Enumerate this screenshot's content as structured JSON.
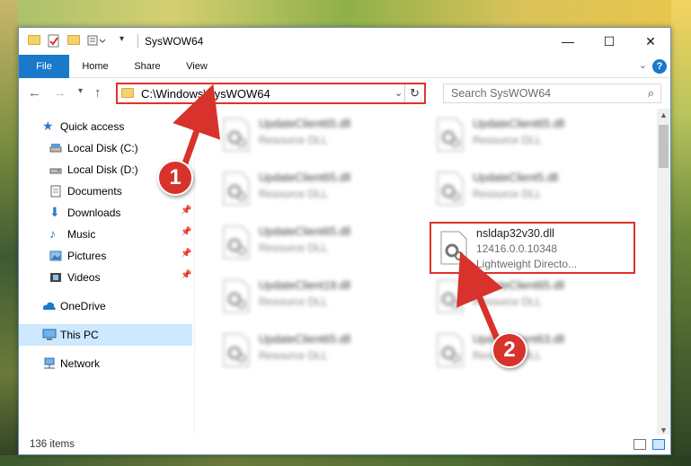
{
  "window": {
    "title": "SysWOW64",
    "minimize_glyph": "—",
    "maximize_glyph": "☐",
    "close_glyph": "✕"
  },
  "ribbon": {
    "tabs": [
      "File",
      "Home",
      "Share",
      "View"
    ],
    "help": "?"
  },
  "address": {
    "path": "C:\\Windows\\SysWOW64"
  },
  "search": {
    "placeholder": "Search SysWOW64"
  },
  "sidebar": {
    "items": [
      {
        "label": "Quick access",
        "icon": "star-icon",
        "pinned": false
      },
      {
        "label": "Local Disk (C:)",
        "icon": "drive-icon",
        "pinned": false
      },
      {
        "label": "Local Disk (D:)",
        "icon": "drive-icon",
        "pinned": false
      },
      {
        "label": "Documents",
        "icon": "documents-icon",
        "pinned": false
      },
      {
        "label": "Downloads",
        "icon": "download-icon",
        "pinned": true
      },
      {
        "label": "Music",
        "icon": "music-icon",
        "pinned": true
      },
      {
        "label": "Pictures",
        "icon": "pictures-icon",
        "pinned": true
      },
      {
        "label": "Videos",
        "icon": "videos-icon",
        "pinned": true
      },
      {
        "label": "OneDrive",
        "icon": "cloud-icon",
        "pinned": false
      },
      {
        "label": "This PC",
        "icon": "computer-icon",
        "pinned": false,
        "selected": true
      },
      {
        "label": "Network",
        "icon": "network-icon",
        "pinned": false
      }
    ]
  },
  "files": [
    {
      "name": "UpdateClient65.dll",
      "desc": "Resource DLL"
    },
    {
      "name": "UpdateClient65.dll",
      "desc": "Resource DLL"
    },
    {
      "name": "UpdateClient65.dll",
      "desc": "Resource DLL"
    },
    {
      "name": "UpdateClient5.dll",
      "desc": "Resource DLL"
    },
    {
      "name": "UpdateClient65.dll",
      "desc": "Resource DLL"
    },
    {
      "name": "nsldap32v30.dll",
      "desc": "12416.0.0.10348",
      "extra": "Lightweight Directo...",
      "highlighted": true
    },
    {
      "name": "UpdateClient19.dll",
      "desc": "Resource DLL"
    },
    {
      "name": "UpdateClient65.dll",
      "desc": "Resource DLL"
    },
    {
      "name": "UpdateClient65.dll",
      "desc": "Resource DLL"
    },
    {
      "name": "UpdateClient63.dll",
      "desc": "Resource DLL"
    }
  ],
  "status": {
    "count": "136 items"
  },
  "callouts": [
    "1",
    "2"
  ],
  "colors": {
    "accent": "#1979ca",
    "highlight_red": "#e0322a",
    "selected_bg": "#cde8ff"
  }
}
